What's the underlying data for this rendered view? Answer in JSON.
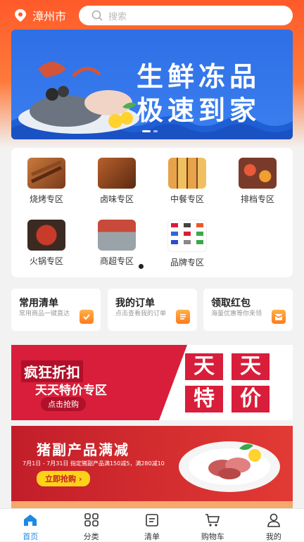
{
  "header": {
    "city": "漳州市",
    "search_placeholder": "搜索"
  },
  "banner": {
    "line1": "生鲜冻品",
    "line2": "极速到家"
  },
  "categories": [
    {
      "label": "烧烤专区"
    },
    {
      "label": "卤味专区"
    },
    {
      "label": "中餐专区"
    },
    {
      "label": "排档专区"
    },
    {
      "label": "火锅专区"
    },
    {
      "label": "商超专区"
    },
    {
      "label": "品牌专区"
    }
  ],
  "quick_cards": [
    {
      "title": "常用清单",
      "subtitle": "常用商品一键直达",
      "icon": "check-list-icon"
    },
    {
      "title": "我的订单",
      "subtitle": "点击查看我的订单",
      "icon": "order-icon"
    },
    {
      "title": "领取红包",
      "subtitle": "海量优惠等你来领",
      "icon": "red-packet-icon"
    }
  ],
  "promo1": {
    "headline": "疯狂折扣",
    "subhead": "天天特价专区",
    "button": "点击抢购",
    "tiles": [
      "天",
      "天",
      "特",
      "价"
    ]
  },
  "promo2": {
    "headline": "猪副产品满减",
    "detail": "7月1日 - 7月31日 指定猪副产品满150减5，满280减10",
    "button": "立即抢购 ›"
  },
  "tabbar": {
    "items": [
      {
        "label": "首页",
        "active": true
      },
      {
        "label": "分类"
      },
      {
        "label": "清单"
      },
      {
        "label": "购物车"
      },
      {
        "label": "我的"
      }
    ]
  },
  "colors": {
    "accent": "#ff5a2a",
    "active_tab": "#1e88e5",
    "promo_red": "#d81e3a"
  }
}
